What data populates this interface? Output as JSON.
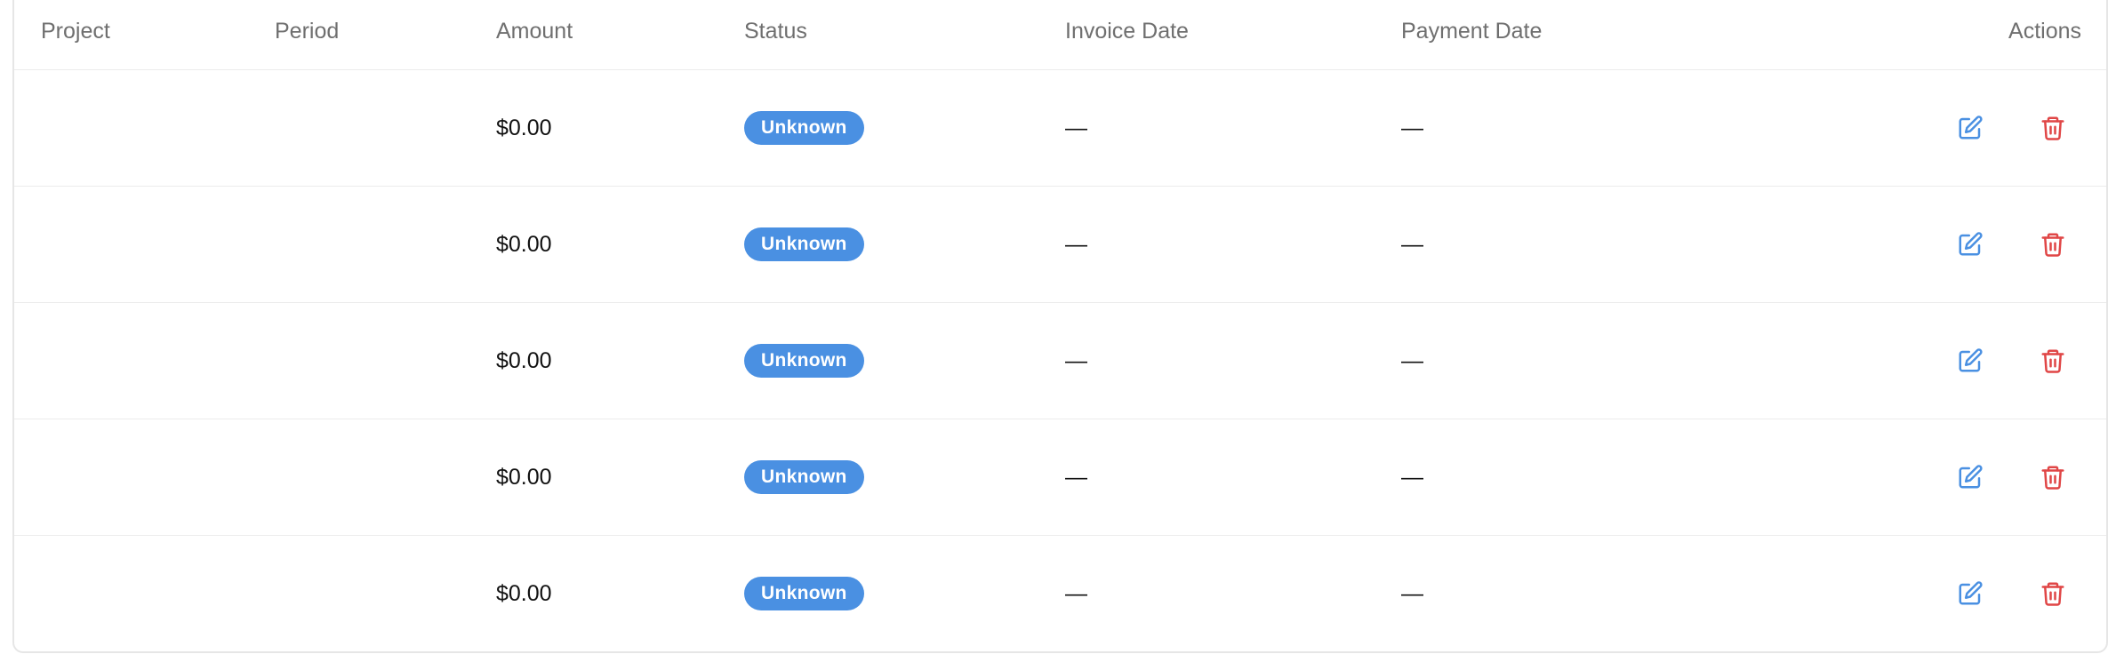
{
  "table": {
    "headers": {
      "project": "Project",
      "period": "Period",
      "amount": "Amount",
      "status": "Status",
      "invoice_date": "Invoice Date",
      "payment_date": "Payment Date",
      "actions": "Actions"
    },
    "rows": [
      {
        "project": "",
        "period": "",
        "amount": "$0.00",
        "status": "Unknown",
        "invoice_date": "—",
        "payment_date": "—"
      },
      {
        "project": "",
        "period": "",
        "amount": "$0.00",
        "status": "Unknown",
        "invoice_date": "—",
        "payment_date": "—"
      },
      {
        "project": "",
        "period": "",
        "amount": "$0.00",
        "status": "Unknown",
        "invoice_date": "—",
        "payment_date": "—"
      },
      {
        "project": "",
        "period": "",
        "amount": "$0.00",
        "status": "Unknown",
        "invoice_date": "—",
        "payment_date": "—"
      },
      {
        "project": "",
        "period": "",
        "amount": "$0.00",
        "status": "Unknown",
        "invoice_date": "—",
        "payment_date": "—"
      }
    ],
    "row_actions": [
      {
        "icon": "edit-icon",
        "color": "#4a90e2"
      },
      {
        "icon": "trash-icon",
        "color": "#e04646"
      }
    ]
  },
  "colors": {
    "status_badge": "#4a90e2",
    "edit_action": "#4a90e2",
    "delete_action": "#e04646"
  }
}
